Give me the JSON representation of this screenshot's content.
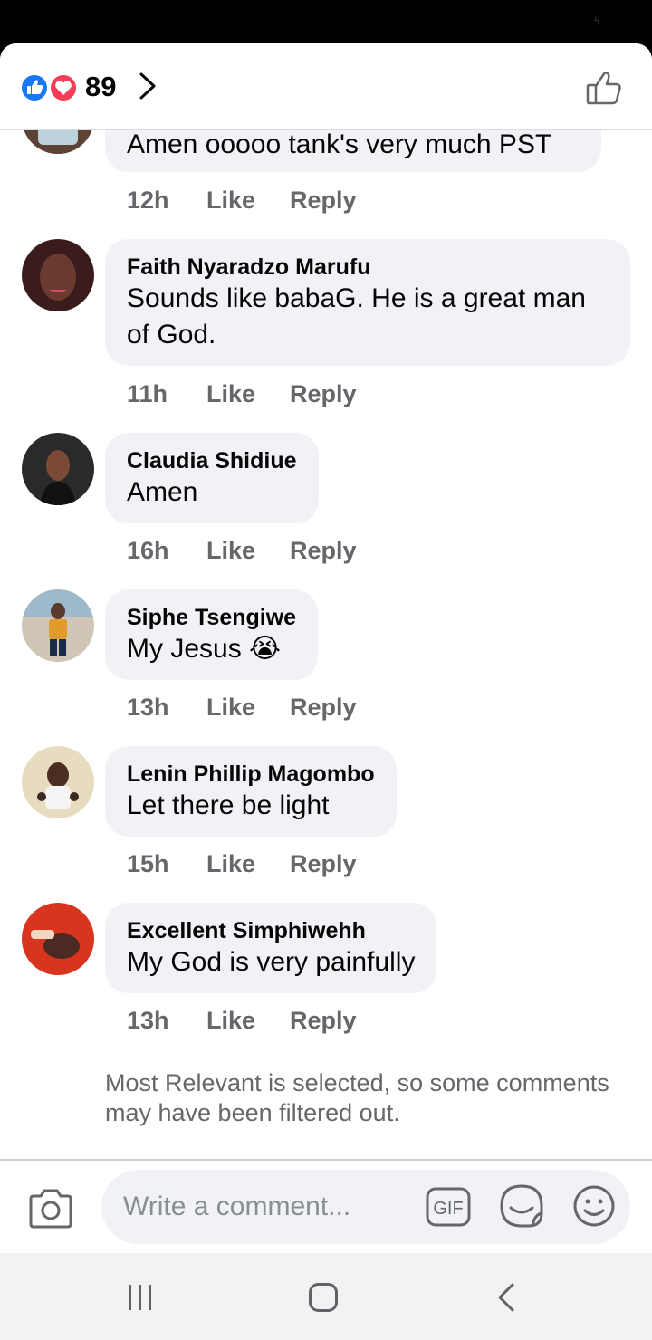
{
  "header": {
    "reaction_count": "89",
    "reaction_icons": [
      "like-icon",
      "love-icon"
    ],
    "chevron_icon": "chevron-right-icon",
    "like_icon": "thumbs-up-outline-icon"
  },
  "comments": [
    {
      "author": "",
      "text": "Amen ooooo tank's very much PST",
      "time": "12h",
      "like": "Like",
      "reply": "Reply"
    },
    {
      "author": "Faith Nyaradzo Marufu",
      "text": "Sounds like babaG. He is a great man of God.",
      "time": "11h",
      "like": "Like",
      "reply": "Reply"
    },
    {
      "author": "Claudia Shidiue",
      "text": "Amen",
      "time": "16h",
      "like": "Like",
      "reply": "Reply"
    },
    {
      "author": "Siphe Tsengiwe",
      "text": "My Jesus 😭",
      "time": "13h",
      "like": "Like",
      "reply": "Reply"
    },
    {
      "author": "Lenin Phillip Magombo",
      "text": "Let there be light",
      "time": "15h",
      "like": "Like",
      "reply": "Reply"
    },
    {
      "author": "Excellent Simphiwehh",
      "text": "My  God is very painfully",
      "time": "13h",
      "like": "Like",
      "reply": "Reply"
    }
  ],
  "filter_note": "Most Relevant is selected, so some comments may have been filtered out.",
  "composer": {
    "placeholder": "Write a comment...",
    "gif_label": "GIF",
    "icons": [
      "camera-icon",
      "gif-icon",
      "sticker-icon",
      "emoji-icon"
    ]
  },
  "colors": {
    "like_blue": "#1877f2",
    "love_red": "#f33e58",
    "bubble_bg": "#f0f2f5",
    "meta_gray": "#65676b"
  },
  "nav": {
    "icons": [
      "recent-apps-icon",
      "home-icon",
      "back-icon"
    ]
  }
}
